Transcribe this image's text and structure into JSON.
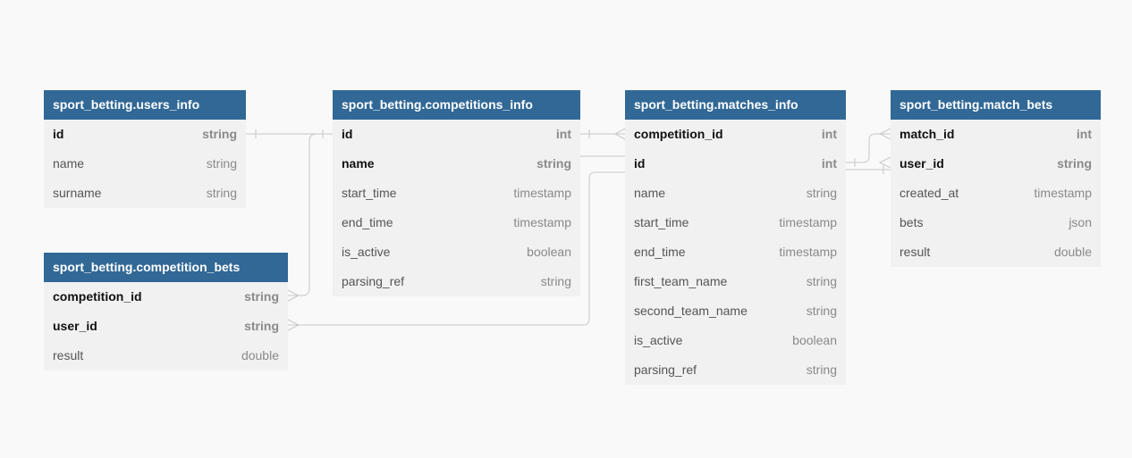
{
  "tables": {
    "users_info": {
      "title": "sport_betting.users_info",
      "fields": [
        {
          "name": "id",
          "type": "string"
        },
        {
          "name": "name",
          "type": "string"
        },
        {
          "name": "surname",
          "type": "string"
        }
      ]
    },
    "competition_bets": {
      "title": "sport_betting.competition_bets",
      "fields": [
        {
          "name": "competition_id",
          "type": "string"
        },
        {
          "name": "user_id",
          "type": "string"
        },
        {
          "name": "result",
          "type": "double"
        }
      ]
    },
    "competitions_info": {
      "title": "sport_betting.competitions_info",
      "fields": [
        {
          "name": "id",
          "type": "int"
        },
        {
          "name": "name",
          "type": "string"
        },
        {
          "name": "start_time",
          "type": "timestamp"
        },
        {
          "name": "end_time",
          "type": "timestamp"
        },
        {
          "name": "is_active",
          "type": "boolean"
        },
        {
          "name": "parsing_ref",
          "type": "string"
        }
      ]
    },
    "matches_info": {
      "title": "sport_betting.matches_info",
      "fields": [
        {
          "name": "competition_id",
          "type": "int"
        },
        {
          "name": "id",
          "type": "int"
        },
        {
          "name": "name",
          "type": "string"
        },
        {
          "name": "start_time",
          "type": "timestamp"
        },
        {
          "name": "end_time",
          "type": "timestamp"
        },
        {
          "name": "first_team_name",
          "type": "string"
        },
        {
          "name": "second_team_name",
          "type": "string"
        },
        {
          "name": "is_active",
          "type": "boolean"
        },
        {
          "name": "parsing_ref",
          "type": "string"
        }
      ]
    },
    "match_bets": {
      "title": "sport_betting.match_bets",
      "fields": [
        {
          "name": "match_id",
          "type": "int"
        },
        {
          "name": "user_id",
          "type": "string"
        },
        {
          "name": "created_at",
          "type": "timestamp"
        },
        {
          "name": "bets",
          "type": "json"
        },
        {
          "name": "result",
          "type": "double"
        }
      ]
    }
  },
  "colors": {
    "header": "#316896",
    "body": "#f1f1f2",
    "background": "#f9f9fa",
    "connector": "#c8c8c8"
  }
}
